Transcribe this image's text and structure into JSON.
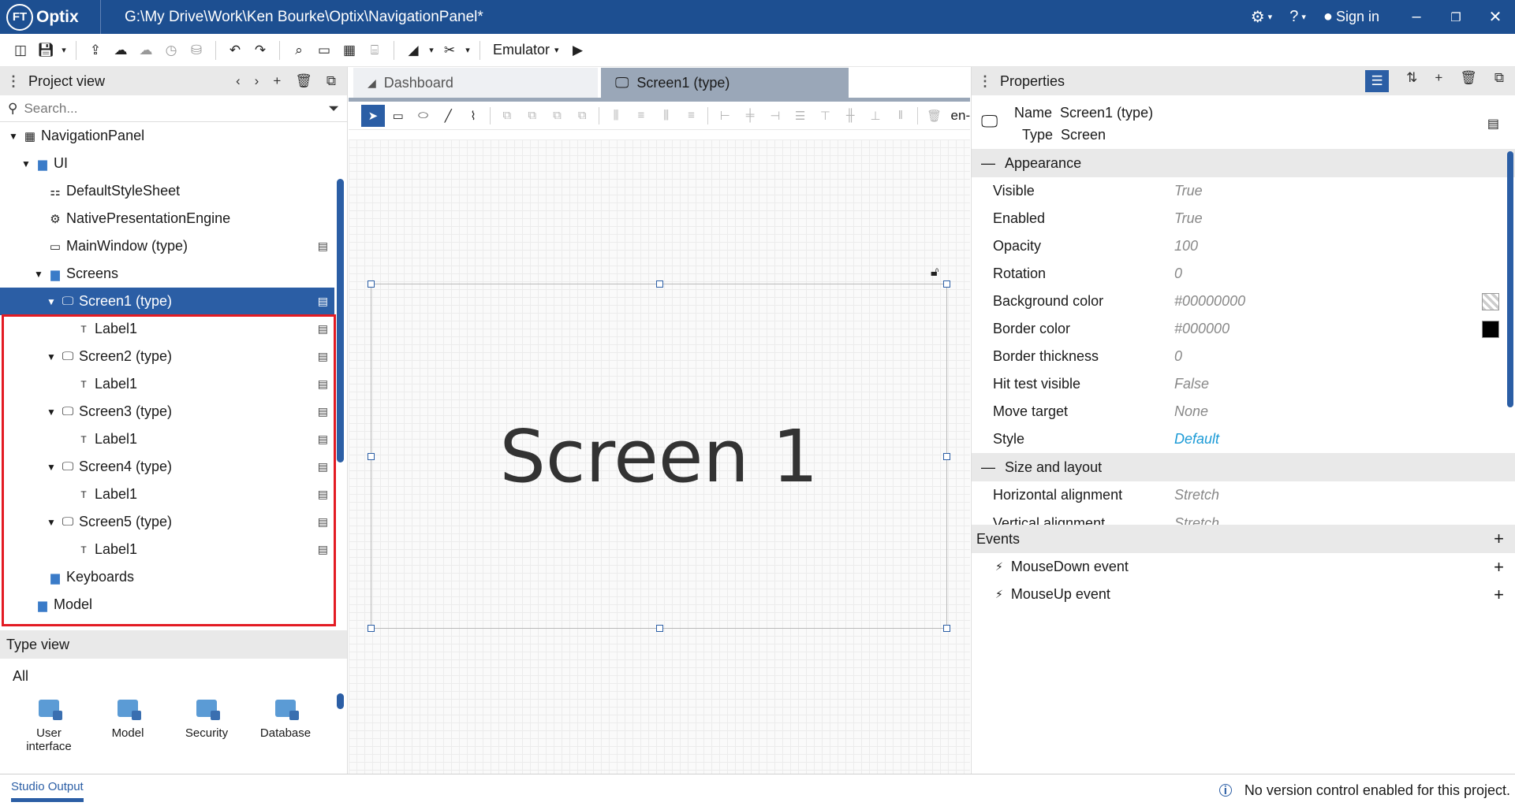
{
  "titlebar": {
    "logo_badge": "FT",
    "logo_text": "Optix",
    "path": "G:\\My Drive\\Work\\Ken Bourke\\Optix\\NavigationPanel*",
    "sign_in": "Sign in"
  },
  "toolbar": {
    "emulator_label": "Emulator"
  },
  "project_view": {
    "title": "Project view",
    "search_placeholder": "Search...",
    "tree": [
      {
        "label": "NavigationPanel",
        "icon": "project-icon"
      },
      {
        "label": "UI",
        "icon": "folder-icon"
      },
      {
        "label": "DefaultStyleSheet",
        "icon": "stylesheet-icon"
      },
      {
        "label": "NativePresentationEngine",
        "icon": "gear-icon"
      },
      {
        "label": "MainWindow (type)",
        "icon": "window-icon"
      },
      {
        "label": "Screens",
        "icon": "folder-icon"
      },
      {
        "label": "Screen1 (type)",
        "icon": "monitor-icon",
        "selected": true
      },
      {
        "label": "Label1",
        "icon": "text-icon"
      },
      {
        "label": "Screen2 (type)",
        "icon": "monitor-icon"
      },
      {
        "label": "Label1",
        "icon": "text-icon"
      },
      {
        "label": "Screen3 (type)",
        "icon": "monitor-icon"
      },
      {
        "label": "Label1",
        "icon": "text-icon"
      },
      {
        "label": "Screen4 (type)",
        "icon": "monitor-icon"
      },
      {
        "label": "Label1",
        "icon": "text-icon"
      },
      {
        "label": "Screen5 (type)",
        "icon": "monitor-icon"
      },
      {
        "label": "Label1",
        "icon": "text-icon"
      },
      {
        "label": "Keyboards",
        "icon": "folder-icon"
      },
      {
        "label": "Model",
        "icon": "folder-icon"
      }
    ]
  },
  "type_view": {
    "title": "Type view",
    "filter": "All",
    "items": [
      {
        "label": "User interface"
      },
      {
        "label": "Model"
      },
      {
        "label": "Security"
      },
      {
        "label": "Database"
      }
    ]
  },
  "editor": {
    "tabs": [
      {
        "label": "Dashboard",
        "active": false
      },
      {
        "label": "Screen1 (type)",
        "active": true
      }
    ],
    "locale": "en-",
    "screen_text": "Screen 1"
  },
  "properties": {
    "title": "Properties",
    "name_label": "Name",
    "name_value": "Screen1 (type)",
    "type_label": "Type",
    "type_value": "Screen",
    "appearance_header": "Appearance",
    "appearance": [
      {
        "name": "Visible",
        "value": "True"
      },
      {
        "name": "Enabled",
        "value": "True"
      },
      {
        "name": "Opacity",
        "value": "100"
      },
      {
        "name": "Rotation",
        "value": "0"
      },
      {
        "name": "Background color",
        "value": "#00000000"
      },
      {
        "name": "Border color",
        "value": "#000000"
      },
      {
        "name": "Border thickness",
        "value": "0"
      },
      {
        "name": "Hit test visible",
        "value": "False"
      },
      {
        "name": "Move target",
        "value": "None"
      },
      {
        "name": "Style",
        "value": "Default"
      }
    ],
    "size_header": "Size and layout",
    "size": [
      {
        "name": "Horizontal alignment",
        "value": "Stretch"
      },
      {
        "name": "Vertical alignment",
        "value": "Stretch"
      }
    ],
    "events_header": "Events",
    "events": [
      {
        "name": "MouseDown event"
      },
      {
        "name": "MouseUp event"
      }
    ]
  },
  "status": {
    "studio_output": "Studio Output",
    "vcs_message": "No version control enabled for this project."
  },
  "colors": {
    "brand": "#1d4f91",
    "selection": "#2b5ea5",
    "highlight_box": "#e31b23",
    "link": "#1a9ad6"
  }
}
